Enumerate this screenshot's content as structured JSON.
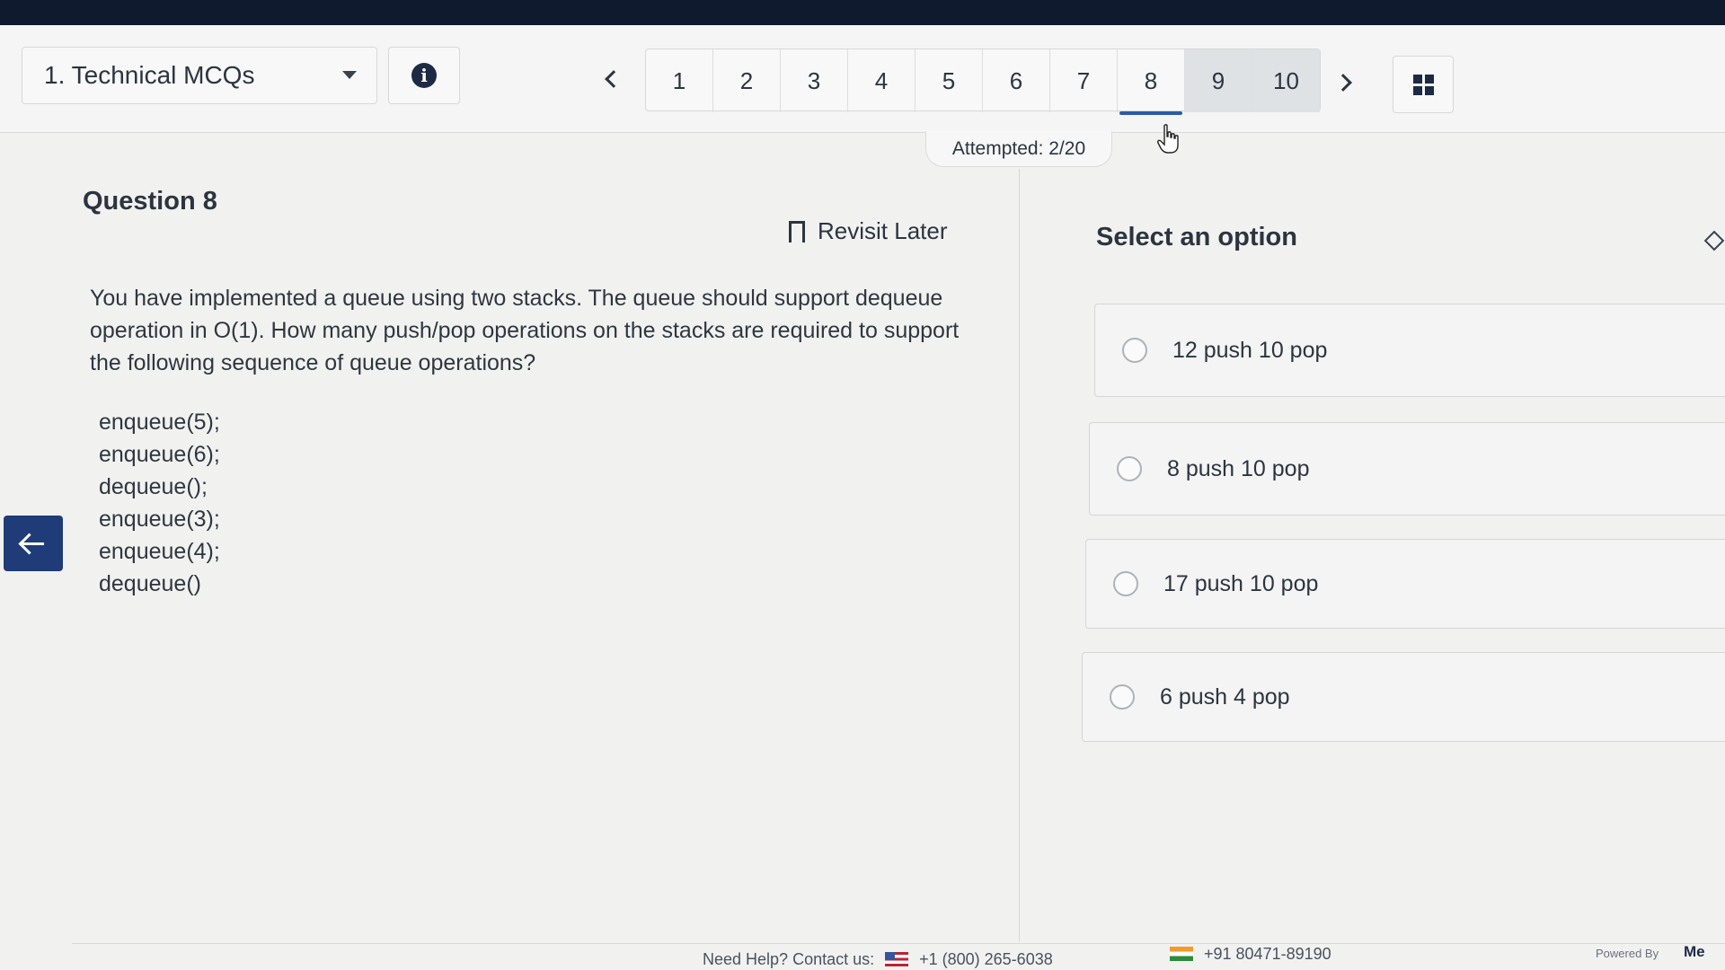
{
  "header": {
    "section_label": "1. Technical MCQs",
    "question_numbers": [
      "1",
      "2",
      "3",
      "4",
      "5",
      "6",
      "7",
      "8",
      "9",
      "10"
    ],
    "current_question": "8",
    "attempted_questions": [
      "9",
      "10"
    ],
    "attempted_text": "Attempted: 2/20"
  },
  "question": {
    "title": "Question 8",
    "revisit_label": "Revisit Later",
    "text": "You have implemented a queue using two stacks. The queue should support dequeue operation in O(1). How many push/pop operations on the stacks are required to support the following sequence of queue operations?",
    "operations": [
      "enqueue(5);",
      "enqueue(6);",
      "dequeue();",
      "enqueue(3);",
      "enqueue(4);",
      "dequeue()"
    ]
  },
  "options": {
    "title": "Select an option",
    "items": [
      "12 push 10 pop",
      "8 push 10 pop",
      "17 push 10 pop",
      "6 push 4 pop"
    ]
  },
  "footer": {
    "help_text": "Need Help? Contact us:",
    "phone_us": "+1 (800) 265-6038",
    "phone_in": "+91 80471-89190",
    "powered_by": "Powered By",
    "brand_partial": "Me"
  },
  "colors": {
    "accent": "#2b5aa8",
    "back_button": "#1f3c78"
  },
  "icons": {
    "info": "info-icon",
    "prev": "chevron-left-icon",
    "next": "chevron-right-icon",
    "grid": "grid-icon",
    "bookmark": "bookmark-icon",
    "back": "arrow-left-icon",
    "cursor": "hand-cursor-icon"
  }
}
